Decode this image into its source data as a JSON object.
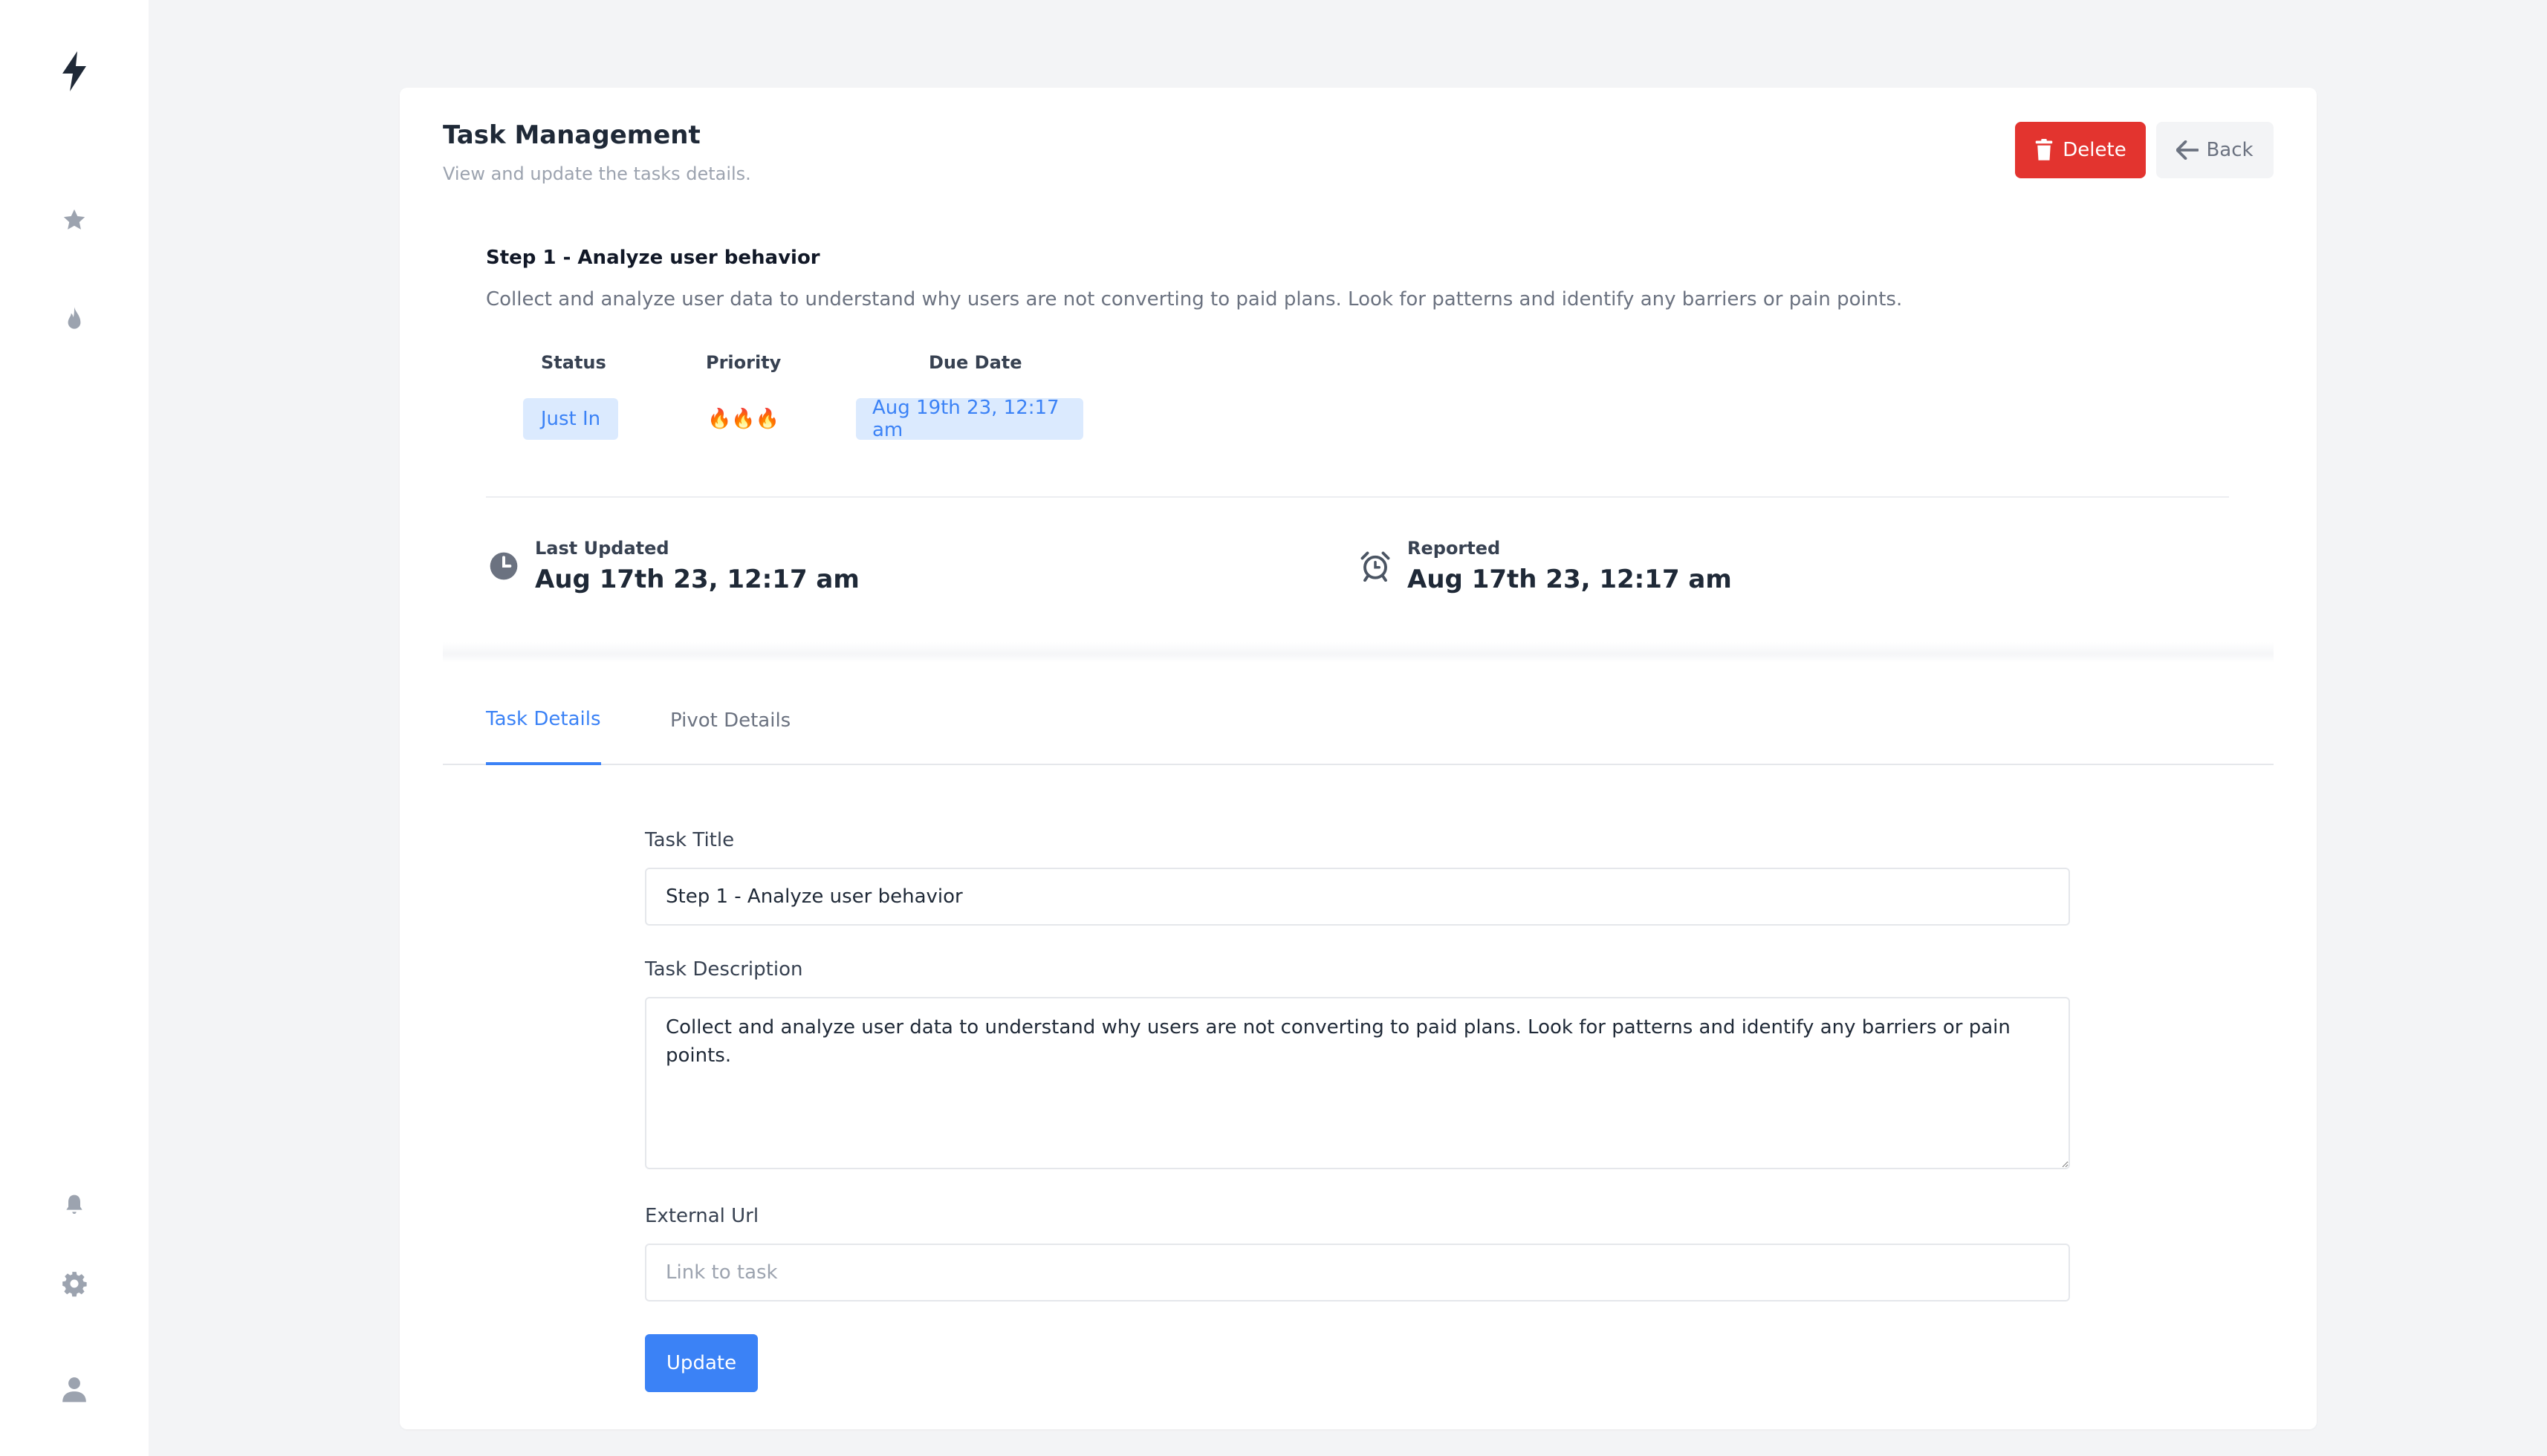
{
  "sidebar": {
    "top_icons": [
      "bolt-icon",
      "star-icon",
      "fire-icon"
    ],
    "bottom_icons": [
      "bell-icon",
      "gear-icon",
      "user-icon"
    ]
  },
  "header": {
    "title": "Task Management",
    "subtitle": "View and update the tasks details.",
    "delete_label": "Delete",
    "back_label": "Back"
  },
  "task": {
    "name": "Step 1 - Analyze user behavior",
    "description": "Collect and analyze user data to understand why users are not converting to paid plans. Look for patterns and identify any barriers or pain points.",
    "status_label": "Status",
    "status": "Just In",
    "priority_label": "Priority",
    "priority": "🔥🔥🔥",
    "due_label": "Due Date",
    "due": "Aug 19th 23, 12:17 am"
  },
  "info": {
    "last_updated_label": "Last Updated",
    "last_updated": "Aug 17th 23, 12:17 am",
    "reported_label": "Reported",
    "reported": "Aug 17th 23, 12:17 am"
  },
  "tabs": [
    {
      "label": "Task Details",
      "active": true
    },
    {
      "label": "Pivot Details",
      "active": false
    }
  ],
  "form": {
    "title_label": "Task Title",
    "title_value": "Step 1 - Analyze user behavior",
    "description_label": "Task Description",
    "description_value": "Collect and analyze user data to understand why users are not converting to paid plans. Look for patterns and identify any barriers or pain points.",
    "url_label": "External Url",
    "url_value": "",
    "url_placeholder": "Link to task",
    "update_label": "Update"
  },
  "colors": {
    "primary": "#3b82f6",
    "danger": "#e3342f",
    "background": "#f3f4f6",
    "badge_bg": "#dbeafe"
  }
}
